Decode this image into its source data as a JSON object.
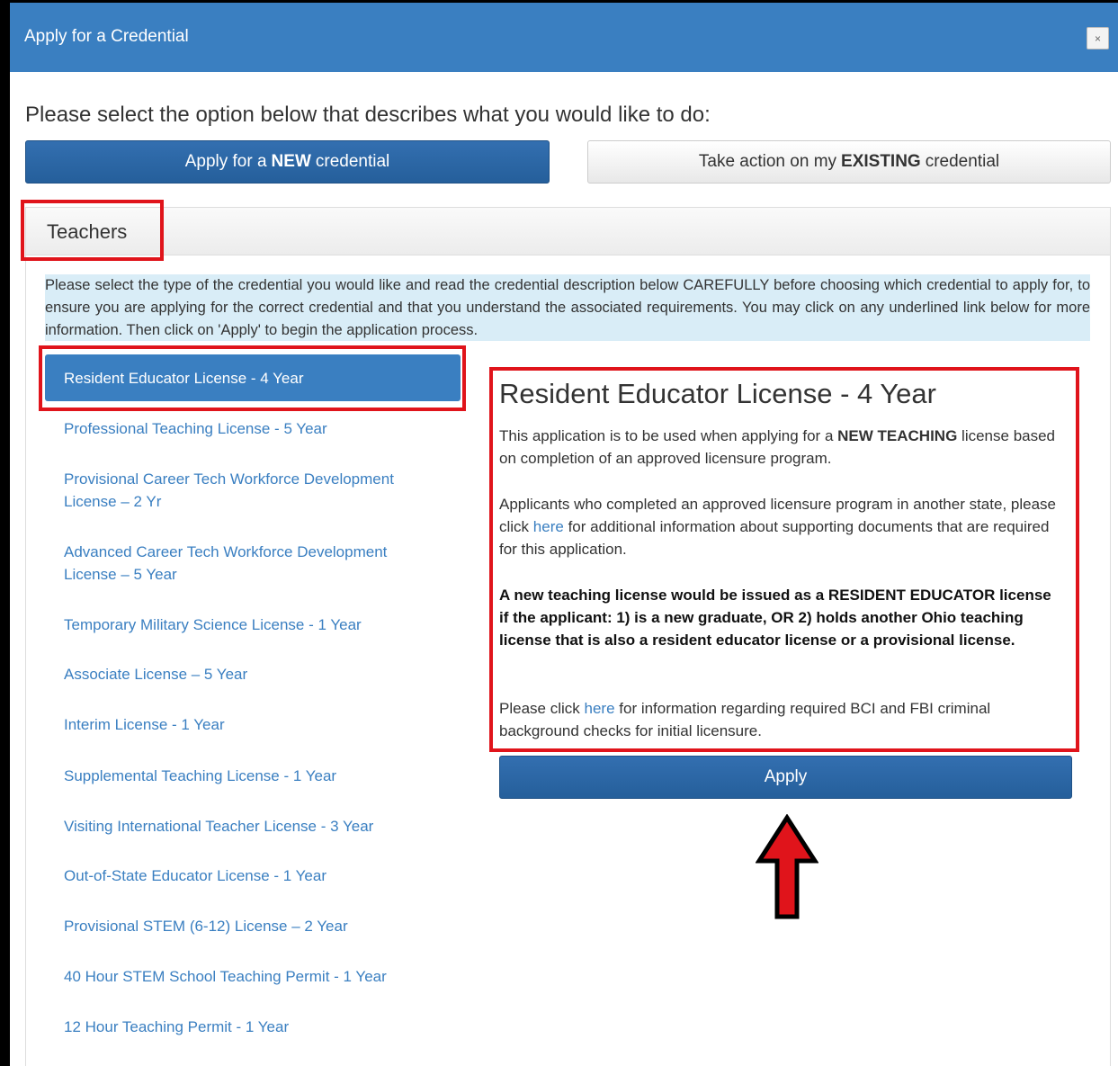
{
  "modal": {
    "title": "Apply for a Credential",
    "close_label": "×"
  },
  "prompt": "Please select the option below that describes what you would like to do:",
  "options": {
    "new_prefix": "Apply for a",
    "new_bold": "NEW",
    "new_suffix": "credential",
    "existing_prefix": "Take action on my",
    "existing_bold": "EXISTING",
    "existing_suffix": "credential"
  },
  "panel": {
    "title": "Teachers",
    "instructions": "Please select the type of the credential you would like and read the credential description below CAREFULLY before choosing which credential to apply for, to ensure you are applying for the correct credential and that you understand the associated requirements. You may click on any underlined link below for more information. Then click on 'Apply' to begin the application process."
  },
  "credentials": [
    {
      "label": "Resident Educator License - 4 Year"
    },
    {
      "label": "Professional Teaching License - 5 Year"
    },
    {
      "label": "Provisional Career Tech Workforce Development License – 2 Yr"
    },
    {
      "label": "Advanced Career Tech Workforce Development License – 5 Year"
    },
    {
      "label": "Temporary Military Science License - 1 Year"
    },
    {
      "label": "Associate License – 5 Year"
    },
    {
      "label": "Interim License - 1 Year"
    },
    {
      "label": "Supplemental Teaching License - 1 Year"
    },
    {
      "label": "Visiting International Teacher License - 3 Year"
    },
    {
      "label": "Out-of-State Educator License - 1 Year"
    },
    {
      "label": "Provisional STEM (6-12) License – 2 Year"
    },
    {
      "label": "40 Hour STEM School Teaching Permit - 1 Year"
    },
    {
      "label": "12 Hour Teaching Permit - 1 Year"
    }
  ],
  "detail": {
    "title": "Resident Educator License - 4 Year",
    "p1_a": "This application is to be used when applying for a",
    "p1_bold": "NEW TEACHING",
    "p1_b": "license based on completion of an approved licensure program.",
    "p2_a": "Applicants who completed an approved licensure program in another state, please click",
    "p2_link": "here",
    "p2_b": "for additional information about supporting documents that are required for this application.",
    "p3": "A new teaching license would be issued as a RESIDENT EDUCATOR license if the applicant: 1) is a new graduate, OR 2) holds another Ohio teaching license that is also a resident educator license or a provisional license.",
    "p4_a": "Please click",
    "p4_link": "here",
    "p4_b": "for information regarding required BCI and FBI criminal background checks for initial licensure.",
    "apply_label": "Apply"
  },
  "colors": {
    "primary": "#3a7fc1",
    "highlight": "#e0141b",
    "info_bg": "#d9edf7"
  }
}
